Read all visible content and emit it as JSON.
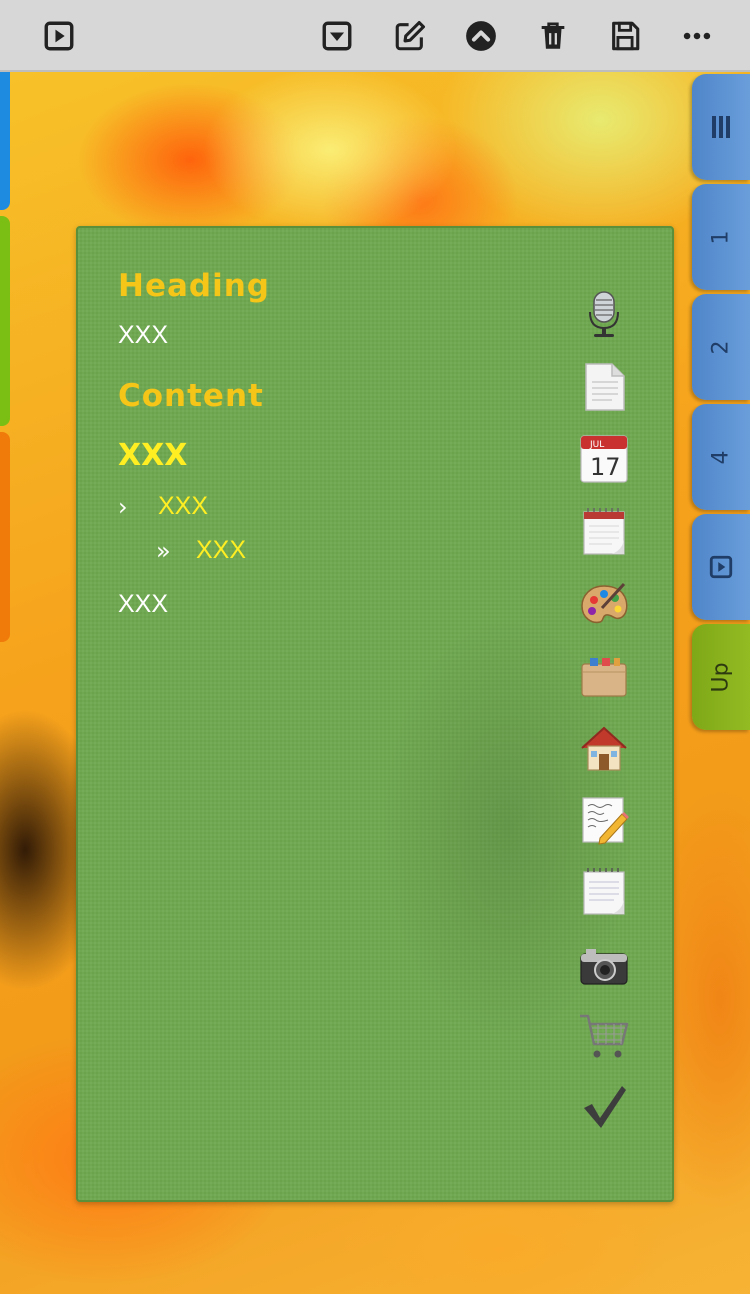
{
  "toolbar": {
    "icons": [
      "play-box-icon",
      "dropdown-box-icon",
      "edit-icon",
      "up-circle-icon",
      "delete-icon",
      "save-icon",
      "more-icon"
    ]
  },
  "side_tabs": [
    {
      "label": "|||",
      "color": "#5b8fd0"
    },
    {
      "label": "1",
      "color": "#5b8fd0"
    },
    {
      "label": "2",
      "color": "#5b8fd0"
    },
    {
      "label": "4",
      "color": "#5b8fd0"
    },
    {
      "label": "",
      "icon": "play-box-icon",
      "color": "#5b8fd0"
    },
    {
      "label": "Up",
      "color": "#86b01a"
    }
  ],
  "note": {
    "heading_title": "Heading",
    "heading_text": "XXX",
    "content_title": "Content",
    "content_heading": "XXX",
    "list": [
      {
        "bullet": "›",
        "text": "XXX"
      },
      {
        "bullet": "»",
        "text": "XXX"
      }
    ],
    "footer_text": "XXX"
  },
  "note_icons": [
    "microphone-icon",
    "document-icon",
    "calendar-icon",
    "notepad-icon",
    "palette-icon",
    "folder-box-icon",
    "home-icon",
    "write-note-icon",
    "memo-pad-icon",
    "camera-icon",
    "shopping-cart-icon",
    "checkmark-icon"
  ],
  "calendar_icon": {
    "month": "JUL",
    "day": "17"
  },
  "colors": {
    "toolbar_bg": "#d7d7d7",
    "panel_bg": "#6fa84f",
    "heading_color": "#f5c518",
    "yellow_text": "#ffee22",
    "tab_blue": "#5b8fd0",
    "tab_green": "#86b01a",
    "edge_blue": "#1e8be0",
    "edge_green": "#7bbf14",
    "edge_orange": "#f07a0a"
  }
}
